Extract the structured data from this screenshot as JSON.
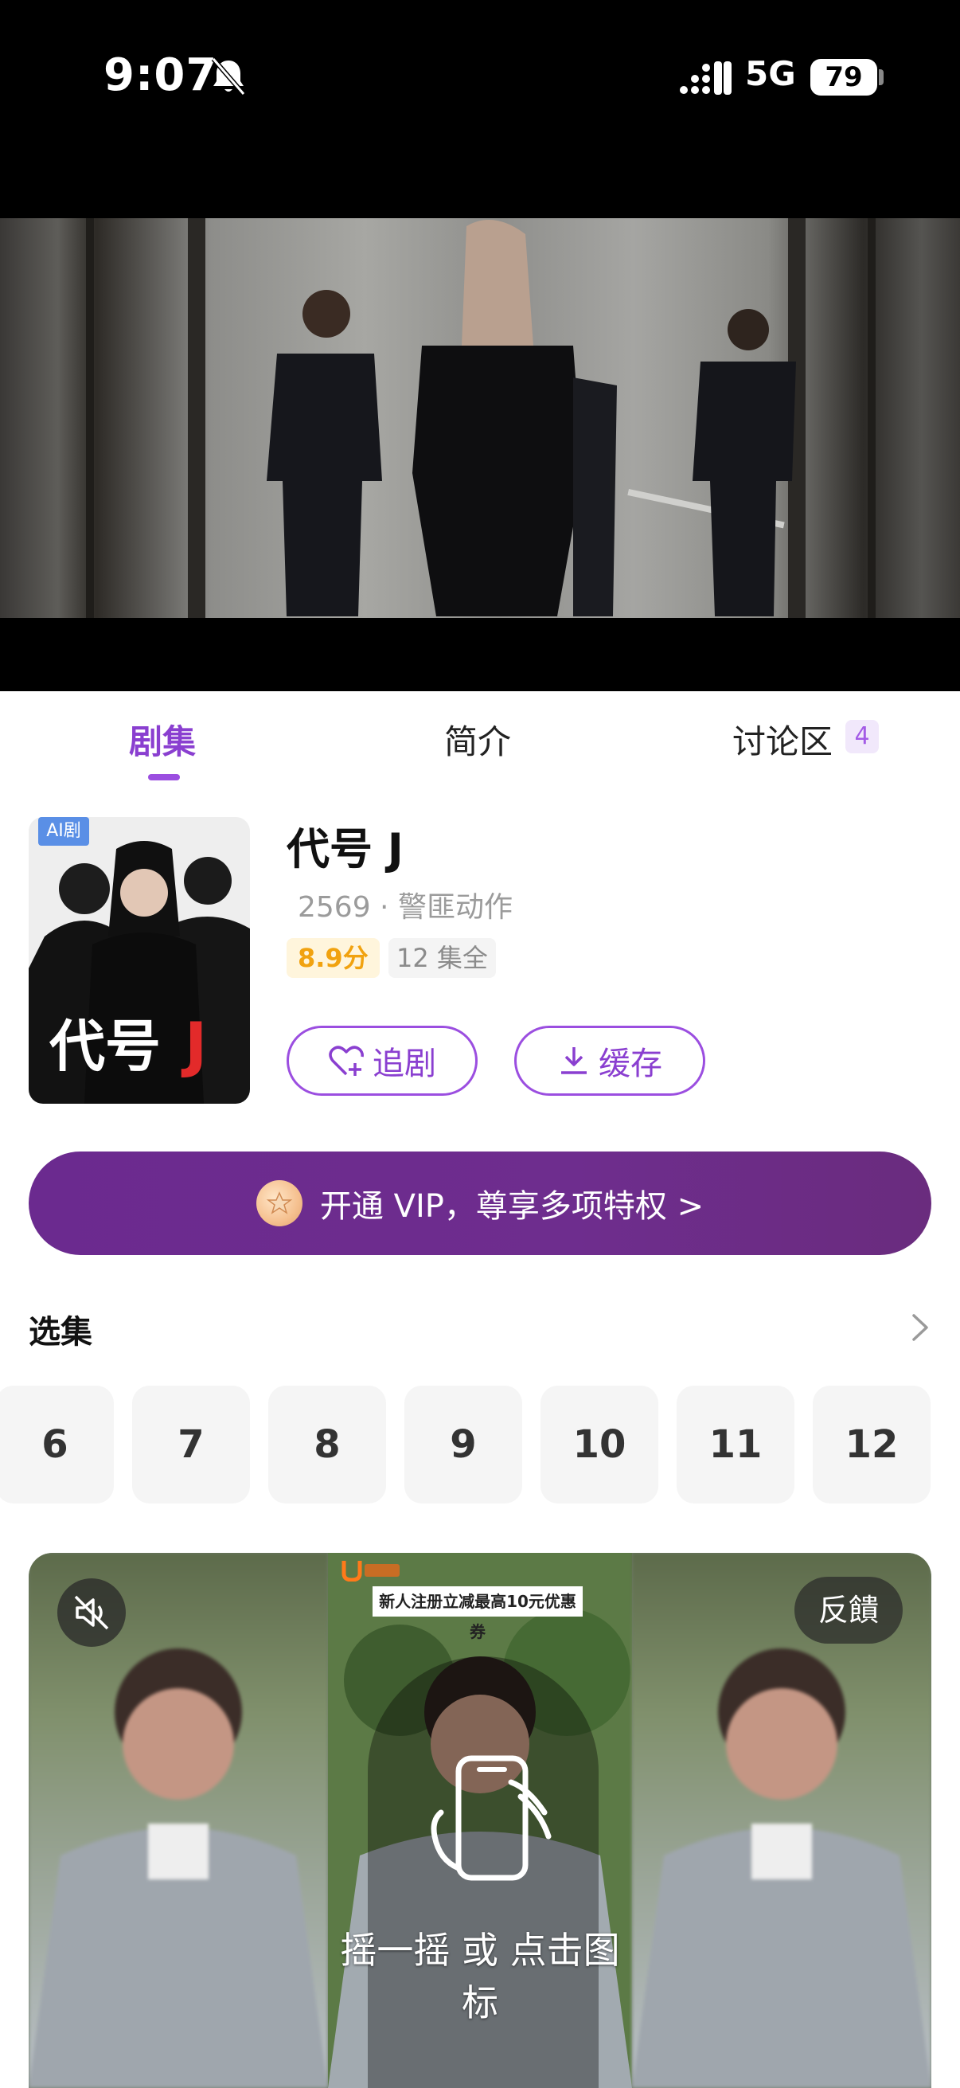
{
  "status_bar": {
    "time": "9:07",
    "network": "5G",
    "battery": "79"
  },
  "tabs": [
    {
      "label": "剧集",
      "active": true
    },
    {
      "label": "简介",
      "active": false
    },
    {
      "label": "讨论区",
      "active": false,
      "badge": "4"
    }
  ],
  "drama": {
    "poster_tag": "AI剧",
    "title": "代号 J",
    "meta": "2569 · 警匪动作",
    "score": "8.9分",
    "episodes_total": "12 集全",
    "follow_label": "追剧",
    "cache_label": "缓存"
  },
  "vip": {
    "label": "开通 VIP，尊享多项特权 >"
  },
  "episode_picker": {
    "title": "选集",
    "episodes": [
      "6",
      "7",
      "8",
      "9",
      "10",
      "11",
      "12"
    ]
  },
  "ad": {
    "feedback_label": "反饋",
    "banner_text": "新人注册立减最高10元优惠券",
    "hint_text": "摇一摇 或 点击图标"
  },
  "colors": {
    "accent": "#8a3fd0",
    "vip_bg": "#6b2a8f",
    "score": "#f1a20f"
  },
  "icons": [
    "silent-bell-icon",
    "signal-icon",
    "heart-plus-icon",
    "download-icon",
    "vip-coin-icon",
    "chevron-right-icon",
    "mute-icon",
    "shake-phone-icon"
  ]
}
